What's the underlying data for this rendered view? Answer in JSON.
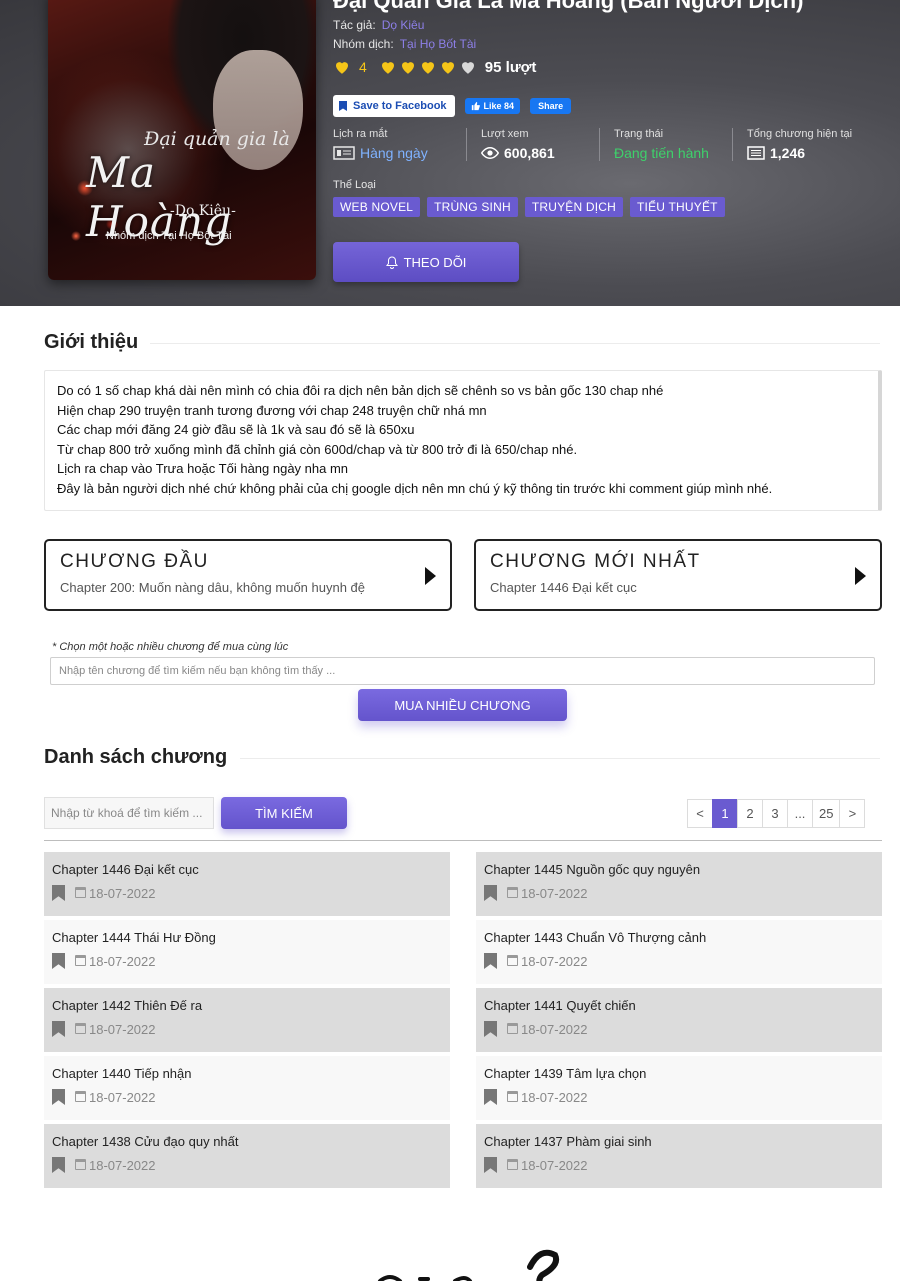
{
  "hero": {
    "title": "Đại Quản Gia Là Ma Hoàng (Bản Người Dịch)",
    "author_label": "Tác giả:",
    "author_value": "Dọ Kiêu",
    "group_label": "Nhóm dịch:",
    "group_value": "Tại Họ Bốt Tài",
    "rating_score": "4",
    "rating_hearts": 4,
    "rating_max": 5,
    "votes": "95 lượt",
    "fb_save": "Save to Facebook",
    "fb_like": "Like 84",
    "fb_share": "Share",
    "stats": [
      {
        "label": "Lịch ra mắt",
        "value": "Hàng ngày",
        "icon": "calendar-grid-icon"
      },
      {
        "label": "Lượt xem",
        "value": "600,861",
        "icon": "eye-icon"
      },
      {
        "label": "Trạng thái",
        "value": "Đang tiến hành",
        "icon": ""
      },
      {
        "label": "Tổng chương hiện tại",
        "value": "1,246",
        "icon": "list-icon"
      }
    ],
    "genres_label": "Thể Loại",
    "genres": [
      "WEB NOVEL",
      "TRÙNG SINH",
      "TRUYỆN DỊCH",
      "TIỂU THUYẾT"
    ],
    "follow": "THEO DÕI",
    "cover": {
      "top": "Đại quản gia là",
      "main": "Ma Hoàng",
      "sub": "-Dọ Kiêu-",
      "group": "Nhóm dịch Tại Họ Bốt Tài"
    }
  },
  "intro": {
    "title": "Giới thiệu",
    "lines": [
      "Do có 1 số chap khá dài nên mình có chia đôi ra dịch nên bản dịch sẽ chênh so vs bản gốc 130 chap nhé",
      "Hiện chap 290 truyện tranh tương đương với chap 248 truyện chữ nhá mn",
      "Các chap mới đăng 24 giờ đầu sẽ là 1k và sau đó sẽ là 650xu",
      "Từ  chap 800 trở xuống mình đã chỉnh giá còn 600d/chap và từ 800 trở đi là 650/chap nhé.",
      "Lịch ra chap vào Trưa hoặc Tối hàng ngày nha mn",
      "Đây là bản người dịch nhé chứ không phải của chị google dịch nên mn chú ý kỹ thông tin trước khi comment giúp mình nhé."
    ]
  },
  "first_chapter": {
    "head": "CHƯƠNG ĐẦU",
    "sub": "Chapter 200: Muốn nàng dâu, không muốn huynh đệ"
  },
  "latest_chapter": {
    "head": "CHƯƠNG MỚI NHẤT",
    "sub": "Chapter 1446 Đại kết cục"
  },
  "buy": {
    "note": "* Chọn một hoặc nhiều chương để mua cùng lúc",
    "placeholder": "Nhập tên chương để tìm kiếm nếu bạn không tìm thấy ...",
    "button": "MUA NHIỀU CHƯƠNG"
  },
  "chapter_list": {
    "title": "Danh sách chương",
    "search_placeholder": "Nhập từ khoá để tìm kiếm ...",
    "search_button": "TÌM KIẾM",
    "pages": [
      "<",
      "1",
      "2",
      "3",
      "...",
      "25",
      ">"
    ],
    "active_page": "1",
    "items": [
      {
        "name": "Chapter 1446 Đại kết cục",
        "date": "18-07-2022"
      },
      {
        "name": "Chapter 1445 Nguồn gốc quy nguyên",
        "date": "18-07-2022"
      },
      {
        "name": "Chapter 1444 Thái Hư Đồng",
        "date": "18-07-2022"
      },
      {
        "name": "Chapter 1443 Chuẩn Vô Thượng cảnh",
        "date": "18-07-2022"
      },
      {
        "name": "Chapter 1442 Thiên Đế ra",
        "date": "18-07-2022"
      },
      {
        "name": "Chapter 1441 Quyết chiến",
        "date": "18-07-2022"
      },
      {
        "name": "Chapter 1440 Tiếp nhận",
        "date": "18-07-2022"
      },
      {
        "name": "Chapter 1439 Tâm lựa chọn",
        "date": "18-07-2022"
      },
      {
        "name": "Chapter 1438 Cửu đạo quy nhất",
        "date": "18-07-2022"
      },
      {
        "name": "Chapter 1437 Phàm giai sinh",
        "date": "18-07-2022"
      }
    ]
  },
  "colors": {
    "accent": "#6a5bd0",
    "heart": "#f5c518",
    "status_green": "#3ed16b",
    "link_blue": "#7fb2ff"
  }
}
